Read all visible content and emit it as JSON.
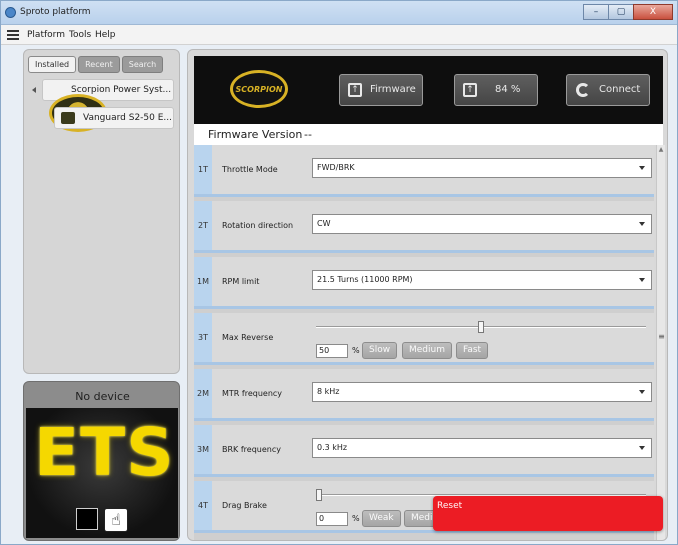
{
  "window": {
    "title": "Sproto platform",
    "controls": {
      "minimize": "–",
      "maximize": "▢",
      "close": "X"
    }
  },
  "menubar": {
    "items": [
      "Platform",
      "Tools",
      "Help"
    ]
  },
  "sidebar": {
    "tabs": [
      "Installed",
      "Recent",
      "Search"
    ],
    "tree": [
      {
        "label": "Scorpion Power Syst..."
      },
      {
        "label": "Vanguard S2-50 E..."
      }
    ],
    "device": {
      "status": "No device",
      "logo_text": "ETS"
    }
  },
  "header": {
    "logo_text": "SCORPION",
    "firmware_label": "Firmware",
    "progress_label": "84 %",
    "connect_label": "Connect"
  },
  "firmware_version": {
    "label": "Firmware Version",
    "value": "--"
  },
  "settings": [
    {
      "code": "1T",
      "name": "Throttle Mode",
      "type": "select",
      "value": "FWD/BRK"
    },
    {
      "code": "2T",
      "name": "Rotation direction",
      "type": "select",
      "value": "CW"
    },
    {
      "code": "1M",
      "name": "RPM limit",
      "type": "select",
      "value": "21.5 Turns (11000 RPM)"
    },
    {
      "code": "3T",
      "name": "Max Reverse",
      "type": "slider",
      "value": "50",
      "unit": "%",
      "slider_fraction": 0.5,
      "presets": [
        "Slow",
        "Medium",
        "Fast"
      ]
    },
    {
      "code": "2M",
      "name": "MTR frequency",
      "type": "select",
      "value": "8 kHz"
    },
    {
      "code": "3M",
      "name": "BRK frequency",
      "type": "select",
      "value": "0.3 kHz"
    },
    {
      "code": "4T",
      "name": "Drag Brake",
      "type": "slider",
      "value": "0",
      "unit": "%",
      "slider_fraction": 0.0,
      "presets": [
        "Weak",
        "Medi"
      ]
    }
  ],
  "scrollbar": {
    "mark": "≡"
  },
  "toast": {
    "label": "Reset",
    "color": "#ec1c24"
  }
}
